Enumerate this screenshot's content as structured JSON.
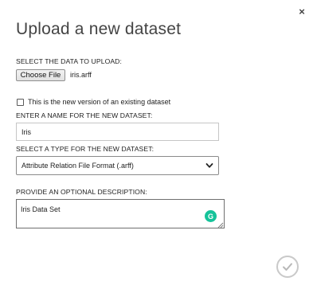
{
  "dialog": {
    "title": "Upload a new dataset",
    "close_label": "×",
    "upload_label": "SELECT THE DATA TO UPLOAD:",
    "choose_file_label": "Choose File",
    "selected_file_name": "iris.arff",
    "new_version_checkbox_label": "This is the new version of an existing dataset",
    "new_version_checked": false,
    "name_label": "ENTER A NAME FOR THE NEW DATASET:",
    "name_value": "Iris",
    "type_label": "SELECT A TYPE FOR THE NEW DATASET:",
    "type_value": "Attribute Relation File Format (.arff)",
    "description_label": "PROVIDE AN OPTIONAL DESCRIPTION:",
    "description_value": "Iris Data Set",
    "grammarly_letter": "G"
  },
  "icons": {
    "close": "close-icon",
    "chevron": "chevron-down-icon",
    "grammarly": "grammarly-icon",
    "confirm": "checkmark-icon"
  },
  "colors": {
    "grammarly": "#15c39a",
    "ok_ring": "#c9c9c9",
    "title": "#444444"
  }
}
